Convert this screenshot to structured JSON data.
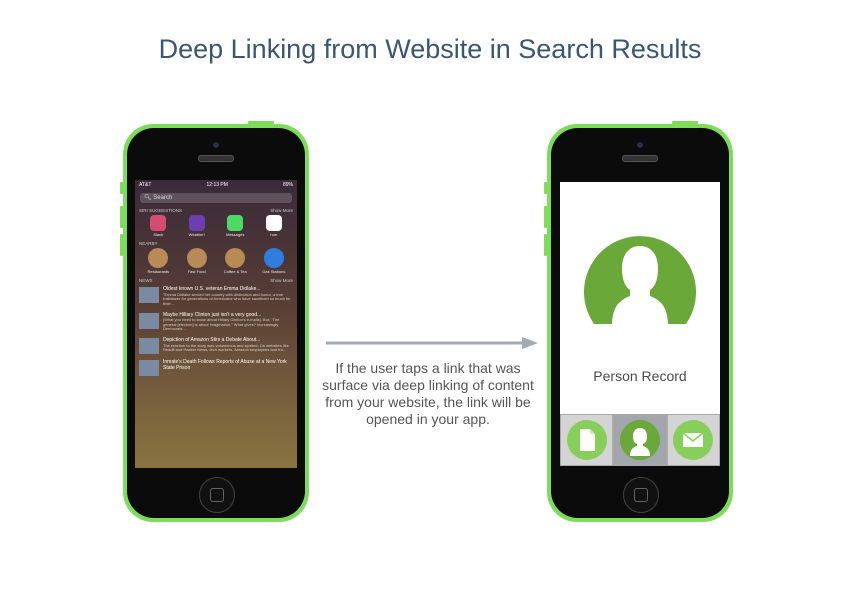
{
  "title": "Deep Linking from Website in Search Results",
  "caption": "If the user taps a link that was surface via deep linking of content from your website, the link will be opened in your app.",
  "colors": {
    "phone": "#7ddc5a",
    "title": "#3a5673",
    "avatar": "#6aa83a",
    "tab_icon": "#86cf5a",
    "arrow": "#a3aab0"
  },
  "left_phone": {
    "status": {
      "carrier": "AT&T",
      "time": "12:13 PM",
      "battery": "89%"
    },
    "search_placeholder": "Search",
    "siri_header": "SIRI SUGGESTIONS",
    "show_more": "Show More",
    "siri_apps": [
      {
        "label": "Slack",
        "color": "#d84b70"
      },
      {
        "label": "Weather!",
        "color": "#6b3fb0"
      },
      {
        "label": "Messages",
        "color": "#4cd964"
      },
      {
        "label": "hue",
        "color": "#ffffff"
      }
    ],
    "nearby_header": "NEARBY",
    "nearby": [
      {
        "label": "Restaurants",
        "color": "#b88a55"
      },
      {
        "label": "Fast Food",
        "color": "#b88a55"
      },
      {
        "label": "Coffee & Tea",
        "color": "#b88a55"
      },
      {
        "label": "Gas Stations",
        "color": "#2f7de1"
      }
    ],
    "news_header": "NEWS",
    "news": [
      {
        "title": "Oldest known U.S. veteran Emma Didlake...",
        "snippet": "\"Emma Didlake served her country with distinction and honor, a true trailblazer for generations of Americans who have sacrificed so much for their..."
      },
      {
        "title": "Maybe Hillary Clinton just isn't a very good...",
        "snippet": "[What you need to know about Hillary Clinton's e-mails]. But, \"The general [election] is about imagination,\" What gives? Increasingly, Democrats..."
      },
      {
        "title": "Depiction of Amazon Stirs a Debate About...",
        "snippet": "The reaction to the story was voluminous and spirited. On websites like Reddit and Hacker News, tech workers, Amazon employees and tra..."
      },
      {
        "title": "Inmate's Death Follows Reports of Abuse at a New York State Prison",
        "snippet": ""
      }
    ]
  },
  "right_phone": {
    "record_label": "Person Record",
    "tabs": [
      "document-icon",
      "person-icon",
      "mail-icon"
    ]
  }
}
